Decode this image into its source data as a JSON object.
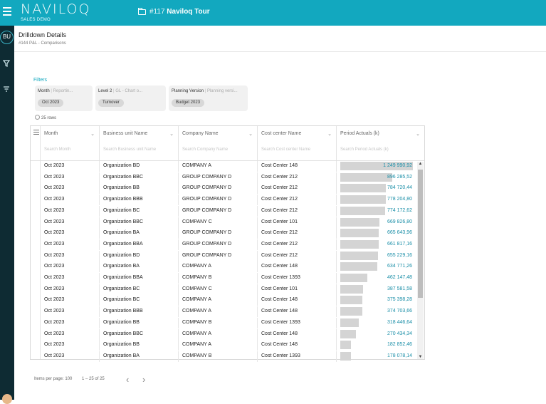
{
  "app": {
    "logo_text": "NAVILOQ",
    "logo_sub": "SALES DEMO",
    "tour_number": "#117",
    "tour_name": "Naviloq Tour",
    "avatar_initials": "BU"
  },
  "page": {
    "title": "Drilldown Details",
    "subtitle": "#144 P&L - Comparisons"
  },
  "filters": {
    "label": "Filters",
    "items": [
      {
        "name": "Month",
        "hint": "Reportin...",
        "value": "Oct 2023"
      },
      {
        "name": "Level 2",
        "hint": "GL - Chart o...",
        "value": "Turnover"
      },
      {
        "name": "Planning Version",
        "hint": "Planning versi...",
        "value": "Budget 2023"
      }
    ]
  },
  "rows_count": "25 rows",
  "columns": [
    {
      "header": "Month",
      "search": "Search Month"
    },
    {
      "header": "Business unit Name",
      "search": "Search Business unit Name"
    },
    {
      "header": "Company Name",
      "search": "Search Company Name"
    },
    {
      "header": "Cost center Name",
      "search": "Search Cost center Name"
    },
    {
      "header": "Period Actuals (k)",
      "search": "Search Period Actuals (k)"
    }
  ],
  "rows": [
    {
      "month": "Oct 2023",
      "bu": "Organization BD",
      "company": "COMPANY A",
      "cc": "Cost Center 148",
      "actuals": "1 249 990,92",
      "raw": 1249990.92
    },
    {
      "month": "Oct 2023",
      "bu": "Organization BBC",
      "company": "GROUP COMPANY D",
      "cc": "Cost Center 212",
      "actuals": "896 285,52",
      "raw": 896285.52
    },
    {
      "month": "Oct 2023",
      "bu": "Organization BB",
      "company": "GROUP COMPANY D",
      "cc": "Cost Center 212",
      "actuals": "784 720,44",
      "raw": 784720.44
    },
    {
      "month": "Oct 2023",
      "bu": "Organization BBB",
      "company": "GROUP COMPANY D",
      "cc": "Cost Center 212",
      "actuals": "778 204,80",
      "raw": 778204.8
    },
    {
      "month": "Oct 2023",
      "bu": "Organization BC",
      "company": "GROUP COMPANY D",
      "cc": "Cost Center 212",
      "actuals": "774 172,62",
      "raw": 774172.62
    },
    {
      "month": "Oct 2023",
      "bu": "Organization BBC",
      "company": "COMPANY C",
      "cc": "Cost Center 101",
      "actuals": "669 826,80",
      "raw": 669826.8
    },
    {
      "month": "Oct 2023",
      "bu": "Organization BA",
      "company": "GROUP COMPANY D",
      "cc": "Cost Center 212",
      "actuals": "665 643,96",
      "raw": 665643.96
    },
    {
      "month": "Oct 2023",
      "bu": "Organization BBA",
      "company": "GROUP COMPANY D",
      "cc": "Cost Center 212",
      "actuals": "661 817,16",
      "raw": 661817.16
    },
    {
      "month": "Oct 2023",
      "bu": "Organization BD",
      "company": "GROUP COMPANY D",
      "cc": "Cost Center 212",
      "actuals": "655 229,16",
      "raw": 655229.16
    },
    {
      "month": "Oct 2023",
      "bu": "Organization BA",
      "company": "COMPANY A",
      "cc": "Cost Center 148",
      "actuals": "634 771,26",
      "raw": 634771.26
    },
    {
      "month": "Oct 2023",
      "bu": "Organization BBA",
      "company": "COMPANY B",
      "cc": "Cost Center 1393",
      "actuals": "462 147,48",
      "raw": 462147.48
    },
    {
      "month": "Oct 2023",
      "bu": "Organization BC",
      "company": "COMPANY C",
      "cc": "Cost Center 101",
      "actuals": "387 581,58",
      "raw": 387581.58
    },
    {
      "month": "Oct 2023",
      "bu": "Organization BC",
      "company": "COMPANY A",
      "cc": "Cost Center 148",
      "actuals": "375 398,28",
      "raw": 375398.28
    },
    {
      "month": "Oct 2023",
      "bu": "Organization BBB",
      "company": "COMPANY A",
      "cc": "Cost Center 148",
      "actuals": "374 703,66",
      "raw": 374703.66
    },
    {
      "month": "Oct 2023",
      "bu": "Organization BB",
      "company": "COMPANY B",
      "cc": "Cost Center 1393",
      "actuals": "318 446,64",
      "raw": 318446.64
    },
    {
      "month": "Oct 2023",
      "bu": "Organization BBC",
      "company": "COMPANY A",
      "cc": "Cost Center 148",
      "actuals": "270 434,34",
      "raw": 270434.34
    },
    {
      "month": "Oct 2023",
      "bu": "Organization BB",
      "company": "COMPANY A",
      "cc": "Cost Center 148",
      "actuals": "182 852,46",
      "raw": 182852.46
    },
    {
      "month": "Oct 2023",
      "bu": "Organization BA",
      "company": "COMPANY B",
      "cc": "Cost Center 1393",
      "actuals": "178 078,14",
      "raw": 178078.14
    }
  ],
  "pager": {
    "items_per_page": "Items per page: 100",
    "range": "1 – 25 of 25"
  },
  "colors": {
    "accent": "#12a8bf",
    "rail": "#0e2b33",
    "bar": "#d4d4d4",
    "value_text": "#1b8fa8"
  }
}
